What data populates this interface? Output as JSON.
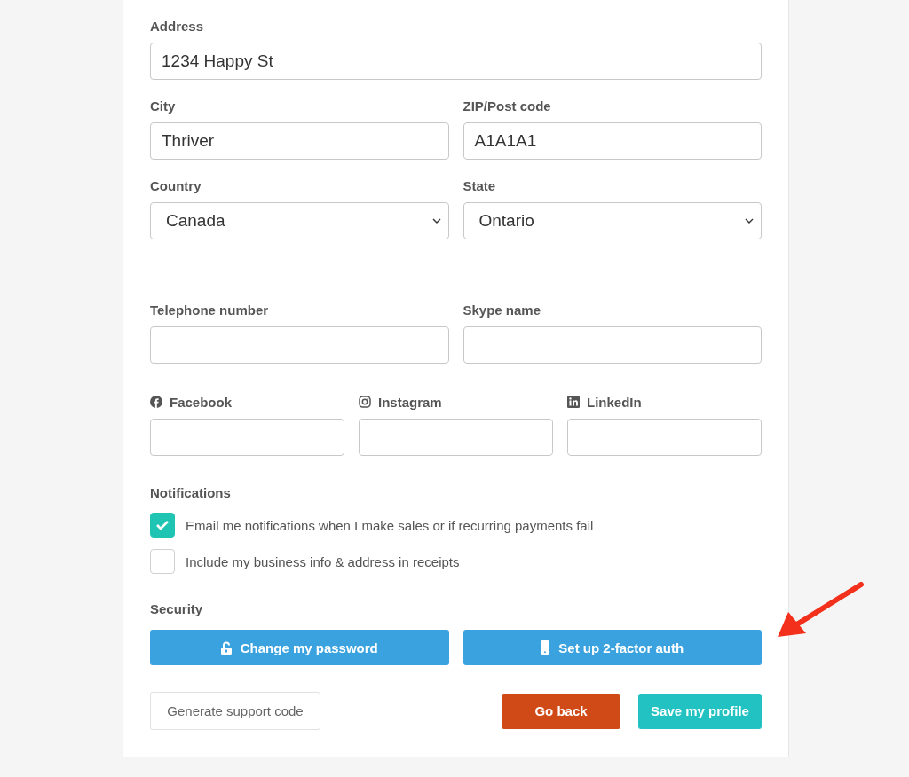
{
  "address_rows": [
    [
      {
        "label": "Address",
        "kind": "text",
        "value": "1234 Happy St"
      }
    ],
    [
      {
        "label": "City",
        "kind": "text",
        "value": "Thriver"
      },
      {
        "label": "ZIP/Post code",
        "kind": "text",
        "value": "A1A1A1"
      }
    ],
    [
      {
        "label": "Country",
        "kind": "select",
        "value": "Canada"
      },
      {
        "label": "State",
        "kind": "select",
        "value": "Ontario"
      }
    ]
  ],
  "contact_rows": [
    [
      {
        "label": "Telephone number",
        "kind": "text"
      },
      {
        "label": "Skype name",
        "kind": "text"
      }
    ],
    [
      {
        "label": "Facebook",
        "kind": "social"
      },
      {
        "label": "Instagram",
        "kind": "social"
      },
      {
        "label": "LinkedIn",
        "kind": "social"
      }
    ]
  ],
  "notifications": {
    "heading": "Notifications",
    "options": [
      {
        "label": "Email me notifications when I make sales or if recurring payments fail",
        "checked": true
      },
      {
        "label": "Include my business info & address in receipts",
        "checked": false
      }
    ]
  },
  "security": {
    "heading": "Security",
    "buttons": [
      {
        "label": "Change my password"
      },
      {
        "label": "Set up 2-factor auth"
      }
    ]
  },
  "actions": [
    {
      "label": "Generate support code",
      "kind": "secondary"
    },
    {
      "label": "Go back",
      "kind": "danger"
    },
    {
      "label": "Save my profile",
      "kind": "primary"
    }
  ]
}
